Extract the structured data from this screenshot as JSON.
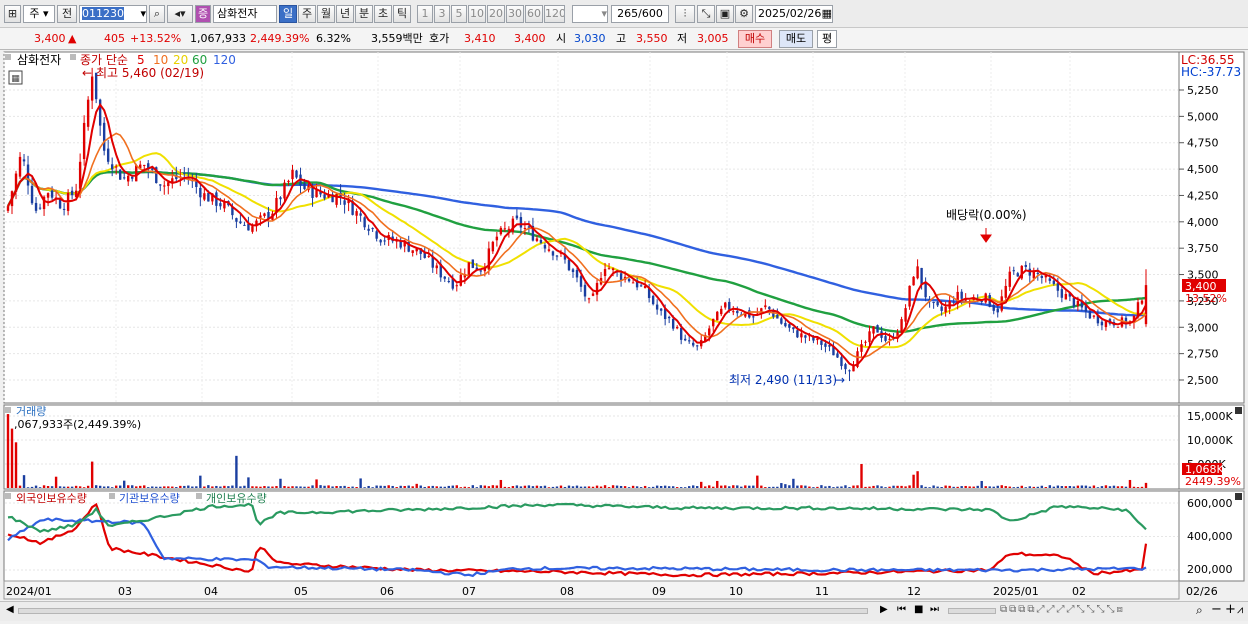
{
  "toolbar": {
    "period_main": "주",
    "prev_label": "전",
    "code": "011230",
    "stock_badge": "증",
    "stock_name": "삼화전자",
    "periods": [
      "일",
      "주",
      "월",
      "년",
      "분",
      "초",
      "틱"
    ],
    "periods_selected": "일",
    "intervals": [
      "1",
      "3",
      "5",
      "10",
      "20",
      "30",
      "60",
      "120"
    ],
    "count": "265",
    "count_max": "/600",
    "date": "2025/02/26"
  },
  "quote": {
    "price": "3,400",
    "arrow": "▲",
    "change": "405",
    "change_pct": "+13.52%",
    "volume": "1,067,933",
    "volume_ratio": "2,449.39%",
    "turnover": "6.32%",
    "amount": "3,559백만",
    "hoga_label": "호가",
    "hoga_sell": "3,410",
    "hoga_buy": "3,400",
    "open_label": "시",
    "open": "3,030",
    "high_label": "고",
    "high": "3,550",
    "low_label": "저",
    "low": "3,005",
    "buy_btn": "매수",
    "sell_btn": "매도",
    "eval_btn": "평"
  },
  "price_panel": {
    "stock_label": "삼화전자",
    "legend_prefix": "종가 단순",
    "ma_periods": [
      "5",
      "10",
      "20",
      "60",
      "120"
    ],
    "lc": "LC:36.55",
    "hc": "HC:-37.73",
    "high_annotation": "최고 5,460 (02/19)",
    "low_annotation": "최저 2,490 (11/13)",
    "dividend_annotation": "배당락(0.00%)",
    "y_ticks": [
      "5,250",
      "5,000",
      "4,750",
      "4,500",
      "4,250",
      "4,000",
      "3,750",
      "3,500",
      "3,250",
      "3,000",
      "2,750",
      "2,500"
    ],
    "current_price_tag": "3,400",
    "current_pct_tag": "13.52%"
  },
  "volume_panel": {
    "title": "거래량",
    "value_label": ",067,933주(2,449.39%)",
    "y_ticks": [
      "15,000K",
      "10,000K",
      "5,000K"
    ],
    "current_tag": "1,068K",
    "pct_tag": "2449.39%"
  },
  "holding_panel": {
    "titles": [
      "외국인보유수량",
      "기관보유수량",
      "개인보유수량"
    ],
    "y_ticks": [
      "600,000",
      "400,000",
      "200,000"
    ]
  },
  "x_axis": {
    "labels": [
      "2024/01",
      "03",
      "04",
      "05",
      "06",
      "07",
      "08",
      "09",
      "10",
      "11",
      "12",
      "2025/01",
      "02"
    ],
    "right_label": "02/26"
  },
  "colors": {
    "up": "#e00000",
    "down": "#1a3ea0",
    "ma5": "#e00000",
    "ma10": "#f07020",
    "ma20": "#f0e000",
    "ma60": "#20a040",
    "ma120": "#3060e0",
    "foreign": "#e00000",
    "institution": "#3060e0",
    "individual": "#2a9a60"
  }
}
